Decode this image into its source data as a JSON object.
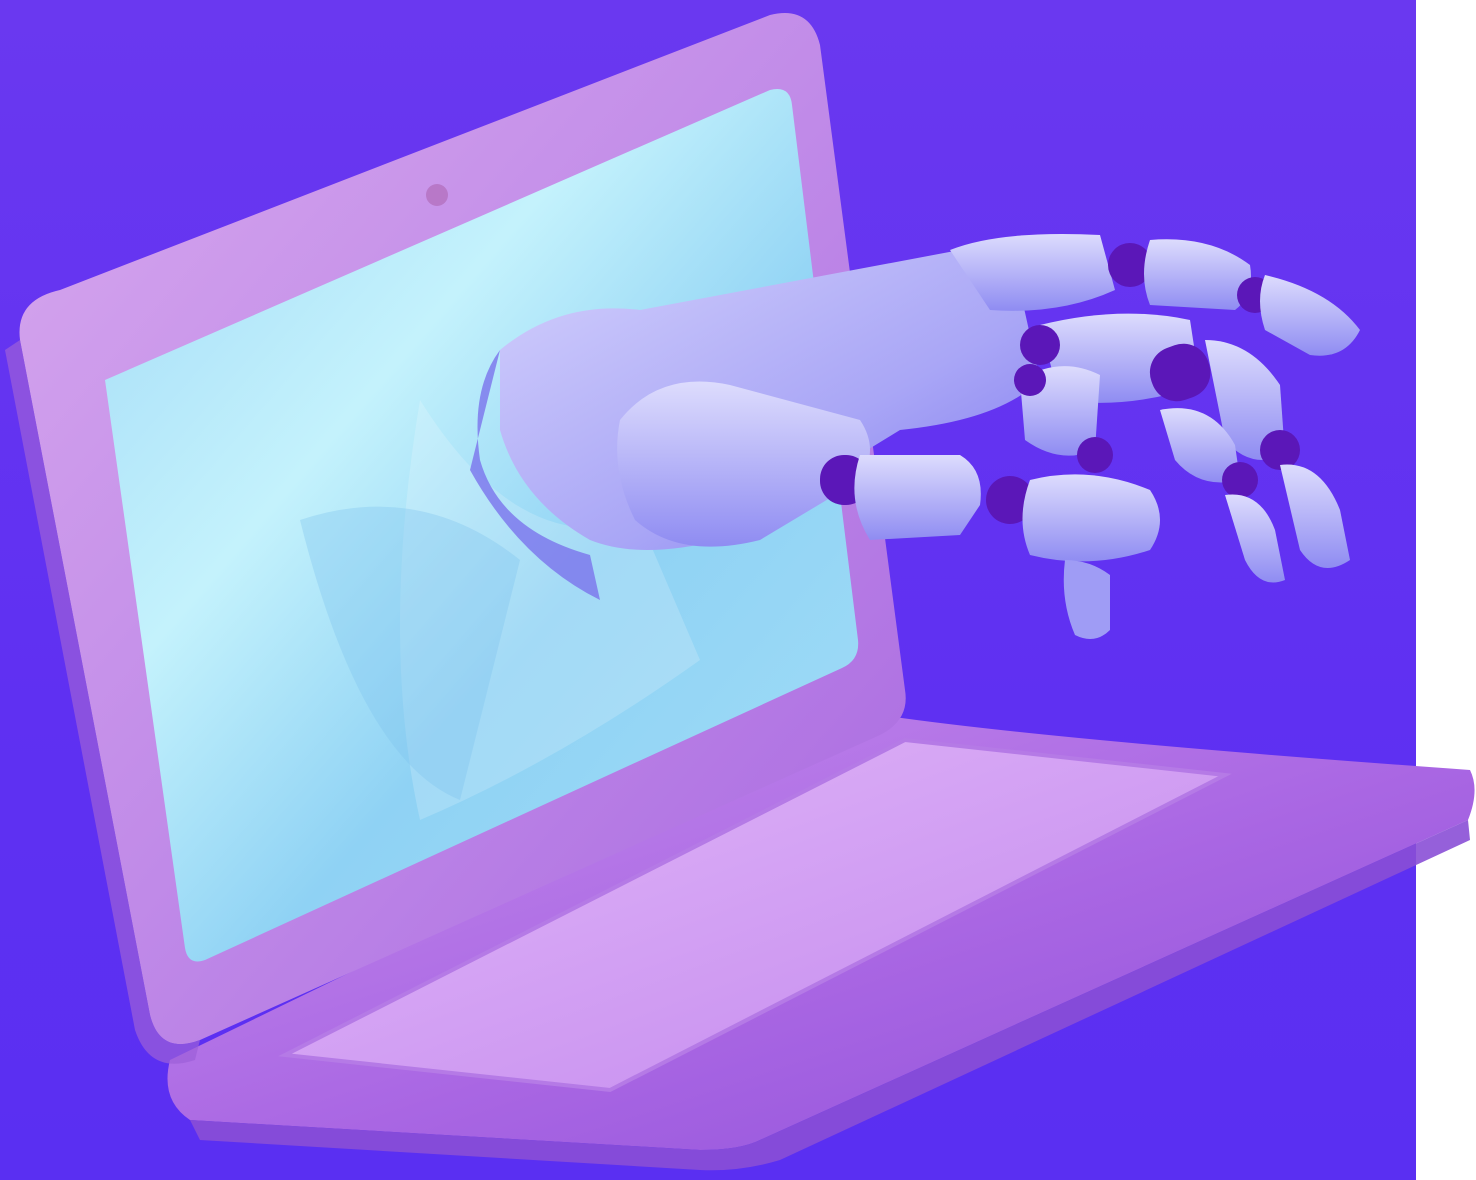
{
  "scene": {
    "subject": "",
    "colors": {
      "background_top": "#6a38f0",
      "background_bottom": "#5a2ff2",
      "laptop_body": "#b87ae6",
      "laptop_body_light": "#d4a6f2",
      "laptop_body_dark": "#8a4fd6",
      "screen_light": "#bff0fb",
      "screen_mid": "#8ad3f2",
      "screen_shadow": "#6aa8ee",
      "robot_light": "#c9c8fb",
      "robot_mid": "#9d9cf4",
      "robot_shadow": "#6a63ea",
      "robot_joint": "#5b17b8"
    },
    "icons": [
      "laptop-icon",
      "robot-hand-icon",
      "webcam-icon"
    ]
  }
}
